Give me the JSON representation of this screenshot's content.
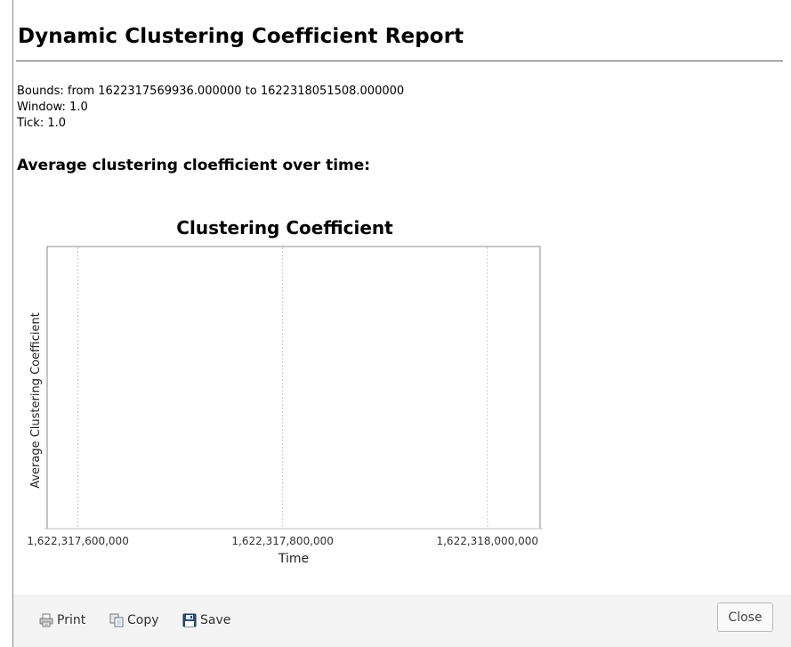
{
  "report": {
    "title": "Dynamic Clustering Coefficient Report",
    "bounds_text": "Bounds: from 1622317569936.000000 to 1622318051508.000000",
    "window_text": "Window: 1.0",
    "tick_text": "Tick: 1.0",
    "section_title": "Average clustering cloefficient over time:"
  },
  "chart_data": {
    "type": "line",
    "title": "Clustering Coefficient",
    "xlabel": "Time",
    "ylabel": "Average Clustering Coefficient",
    "xlim": [
      1622317569936,
      1622318051508
    ],
    "xticks": [
      1622317600000,
      1622317800000,
      1622318000000
    ],
    "xtick_labels": [
      "1,622,317,600,000",
      "1,622,317,800,000",
      "1,622,318,000,000"
    ],
    "series": [],
    "grid": true,
    "legend": "none"
  },
  "footer": {
    "print_label": "Print",
    "copy_label": "Copy",
    "save_label": "Save",
    "close_label": "Close"
  },
  "icons": {
    "print": "printer-icon",
    "copy": "copy-icon",
    "save": "floppy-disk-icon"
  }
}
